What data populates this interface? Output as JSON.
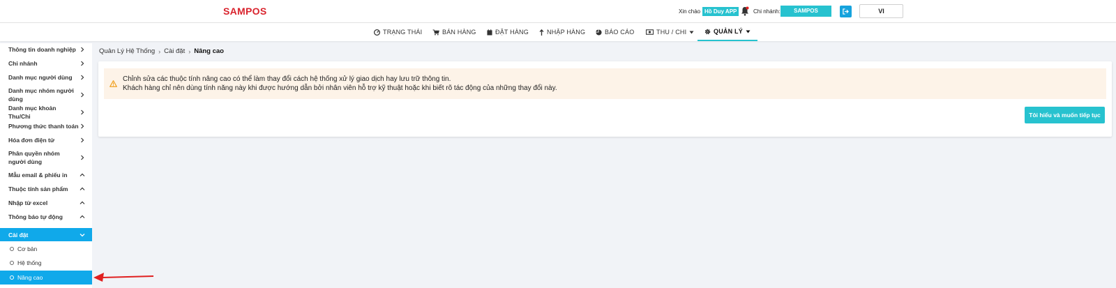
{
  "header": {
    "brand": "SAMPOS",
    "greeting": "Xin chào",
    "user": "Hồ Duy APP",
    "branch_label": "Chi nhánh:",
    "branch": "SAMPOS",
    "language": "VI",
    "icons": [
      "bell-icon",
      "logout-icon"
    ]
  },
  "nav": {
    "items": [
      {
        "label": "TRẠNG THÁI",
        "icon": "dashboard-icon"
      },
      {
        "label": "BÁN HÀNG",
        "icon": "cart-icon"
      },
      {
        "label": "ĐẶT HÀNG",
        "icon": "calendar-icon"
      },
      {
        "label": "NHẬP HÀNG",
        "icon": "arrow-up-icon"
      },
      {
        "label": "BÁO CÁO",
        "icon": "pie-chart-icon"
      },
      {
        "label": "THU / CHI",
        "icon": "money-icon"
      },
      {
        "label": "QUẢN LÝ",
        "icon": "gear-icon",
        "active": true
      }
    ]
  },
  "sidebar": {
    "items": [
      {
        "label": "Thông tin doanh nghiệp",
        "chevron": "right"
      },
      {
        "label": "Chi nhánh",
        "chevron": "right"
      },
      {
        "label": "Danh mục người dùng",
        "chevron": "right"
      },
      {
        "label": "Danh mục nhóm người dùng",
        "chevron": "right"
      },
      {
        "label": "Danh mục khoản Thu/Chi",
        "chevron": "right"
      },
      {
        "label": "Phương thức thanh toán",
        "chevron": "right"
      },
      {
        "label": "Hóa đơn điện tử",
        "chevron": "right"
      },
      {
        "label": "Phân quyền nhóm người dùng",
        "chevron": "right"
      },
      {
        "label": "Mẫu email & phiếu in",
        "chevron": "up"
      },
      {
        "label": "Thuộc tính sản phẩm",
        "chevron": "up"
      },
      {
        "label": "Nhập từ excel",
        "chevron": "up"
      },
      {
        "label": "Thông báo tự động",
        "chevron": "up"
      },
      {
        "label": "Cài đặt",
        "chevron": "down",
        "active": true
      }
    ],
    "sub_items": [
      {
        "label": "Cơ bản"
      },
      {
        "label": "Hệ thống"
      },
      {
        "label": "Nâng cao",
        "active": true
      }
    ]
  },
  "breadcrumb": [
    "Quản Lý Hệ Thống",
    "Cài đặt",
    "Nâng cao"
  ],
  "warning": {
    "line1": "Chỉnh sửa các thuộc tính nâng cao có thể làm thay đổi cách hệ thống xử lý giao dịch hay lưu trữ thông tin.",
    "line2": "Khách hàng chỉ nên dùng tính năng này khi được hướng dẫn bởi nhân viên hỗ trợ kỹ thuật hoặc khi biết rõ tác động của những thay đổi này."
  },
  "continue_button": "Tôi hiểu và muốn tiếp tục",
  "colors": {
    "brand": "#d9232d",
    "accent": "#27c2cf",
    "sidebar_active": "#10a9ea",
    "warning_bg": "#fdf3e8",
    "warning_icon": "#f0a020",
    "annotation_arrow": "#e02020"
  }
}
